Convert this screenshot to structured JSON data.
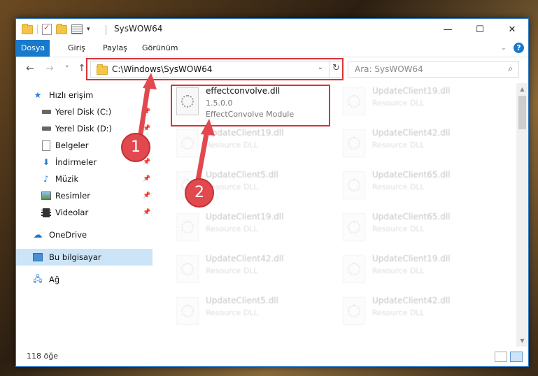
{
  "window": {
    "title": "SysWOW64",
    "controls": {
      "minimize": "—",
      "maximize": "☐",
      "close": "✕"
    }
  },
  "ribbon": {
    "tabs": [
      "Dosya",
      "Giriş",
      "Paylaş",
      "Görünüm"
    ],
    "help": "?"
  },
  "nav": {
    "back": "←",
    "forward": "→",
    "recent": "˅",
    "up": "↑",
    "address": "C:\\Windows\\SysWOW64",
    "search_placeholder": "Ara: SysWOW64"
  },
  "sidebar": {
    "items": [
      {
        "label": "Hızlı erişim",
        "icon": "star-icon",
        "pinned": false
      },
      {
        "label": "Yerel Disk (C:)",
        "icon": "drive-icon",
        "pinned": true
      },
      {
        "label": "Yerel Disk (D:)",
        "icon": "drive-icon",
        "pinned": true
      },
      {
        "label": "Belgeler",
        "icon": "documents-icon",
        "pinned": true
      },
      {
        "label": "İndirmeler",
        "icon": "download-icon",
        "pinned": true
      },
      {
        "label": "Müzik",
        "icon": "music-icon",
        "pinned": true
      },
      {
        "label": "Resimler",
        "icon": "pictures-icon",
        "pinned": true
      },
      {
        "label": "Videolar",
        "icon": "video-icon",
        "pinned": true
      },
      {
        "label": "OneDrive",
        "icon": "cloud-icon",
        "pinned": false
      },
      {
        "label": "Bu bilgisayar",
        "icon": "computer-icon",
        "pinned": false,
        "selected": true
      },
      {
        "label": "Ağ",
        "icon": "network-icon",
        "pinned": false
      }
    ]
  },
  "files": [
    {
      "name": "effectconvolve.dll",
      "line2": "1.5.0.0",
      "line3": "EffectConvolve Module",
      "highlighted": true
    },
    {
      "name": "UpdateClient19.dll",
      "line2": "Resource DLL"
    },
    {
      "name": "UpdateClient19.dll",
      "line2": "Resource DLL"
    },
    {
      "name": "UpdateClient42.dll",
      "line2": "Resource DLL"
    },
    {
      "name": "UpdateClient5.dll",
      "line2": "Resource DLL"
    },
    {
      "name": "UpdateClient65.dll",
      "line2": "Resource DLL"
    },
    {
      "name": "UpdateClient19.dll",
      "line2": "Resource DLL"
    },
    {
      "name": "UpdateClient65.dll",
      "line2": "Resource DLL"
    },
    {
      "name": "UpdateClient42.dll",
      "line2": "Resource DLL"
    },
    {
      "name": "UpdateClient19.dll",
      "line2": "Resource DLL"
    },
    {
      "name": "UpdateClient5.dll",
      "line2": "Resource DLL"
    },
    {
      "name": "UpdateClient42.dll",
      "line2": "Resource DLL"
    }
  ],
  "status": {
    "count": "118 öğe"
  },
  "callouts": [
    "1",
    "2"
  ],
  "colors": {
    "accent": "#1979ca",
    "annotation": "#d9333a",
    "selection": "#cce4f7"
  }
}
